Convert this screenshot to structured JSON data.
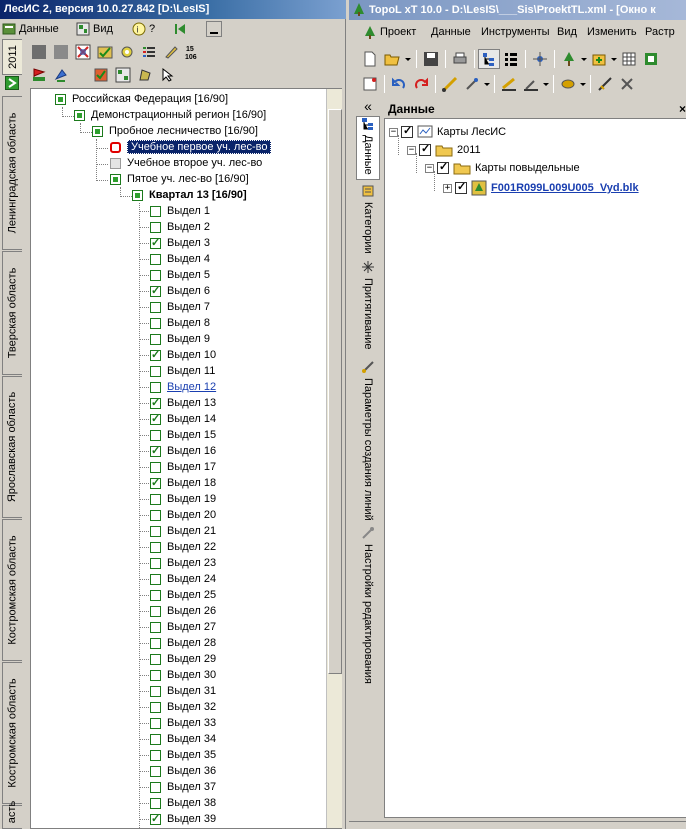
{
  "left_window": {
    "title": "ЛесИС 2, версия 10.0.27.842  [D:\\LesIS]",
    "menu": {
      "data_label": "Данные",
      "view_label": "Вид",
      "help_label": "?"
    },
    "vertical_tabs": [
      "2011",
      "Ленинградская область",
      "Тверская область",
      "Ярославская область",
      "Костромская область",
      "Костромская область",
      "асть"
    ],
    "tree": {
      "root": "Российская Федерация [16/90]",
      "region": "Демонстрационный  регион [16/90]",
      "forestry": "Пробное лесничество [16/90]",
      "districts": [
        "Учебное первое уч. лес-во",
        "Учебное второе уч. лес-во",
        "Пятое уч. лес-во [16/90]"
      ],
      "quarter": "Квартал 13 [16/90]",
      "plots": [
        {
          "label": "Выдел 1",
          "checked": false
        },
        {
          "label": "Выдел 2",
          "checked": false
        },
        {
          "label": "Выдел 3",
          "checked": true
        },
        {
          "label": "Выдел 4",
          "checked": false
        },
        {
          "label": "Выдел 5",
          "checked": false
        },
        {
          "label": "Выдел 6",
          "checked": true
        },
        {
          "label": "Выдел 7",
          "checked": false
        },
        {
          "label": "Выдел 8",
          "checked": false
        },
        {
          "label": "Выдел 9",
          "checked": false
        },
        {
          "label": "Выдел 10",
          "checked": true
        },
        {
          "label": "Выдел 11",
          "checked": false
        },
        {
          "label": "Выдел 12",
          "checked": false
        },
        {
          "label": "Выдел 13",
          "checked": true
        },
        {
          "label": "Выдел 14",
          "checked": true
        },
        {
          "label": "Выдел 15",
          "checked": false
        },
        {
          "label": "Выдел 16",
          "checked": true
        },
        {
          "label": "Выдел 17",
          "checked": false
        },
        {
          "label": "Выдел 18",
          "checked": true
        },
        {
          "label": "Выдел 19",
          "checked": false
        },
        {
          "label": "Выдел 20",
          "checked": false
        },
        {
          "label": "Выдел 21",
          "checked": false
        },
        {
          "label": "Выдел 22",
          "checked": false
        },
        {
          "label": "Выдел 23",
          "checked": false
        },
        {
          "label": "Выдел 24",
          "checked": false
        },
        {
          "label": "Выдел 25",
          "checked": false
        },
        {
          "label": "Выдел 26",
          "checked": false
        },
        {
          "label": "Выдел 27",
          "checked": false
        },
        {
          "label": "Выдел 28",
          "checked": false
        },
        {
          "label": "Выдел 29",
          "checked": false
        },
        {
          "label": "Выдел 30",
          "checked": false
        },
        {
          "label": "Выдел 31",
          "checked": false
        },
        {
          "label": "Выдел 32",
          "checked": false
        },
        {
          "label": "Выдел 33",
          "checked": false
        },
        {
          "label": "Выдел 34",
          "checked": false
        },
        {
          "label": "Выдел 35",
          "checked": false
        },
        {
          "label": "Выдел 36",
          "checked": false
        },
        {
          "label": "Выдел 37",
          "checked": false
        },
        {
          "label": "Выдел 38",
          "checked": false
        },
        {
          "label": "Выдел 39",
          "checked": true
        }
      ],
      "link_plot": "Выдел 12"
    }
  },
  "right_window": {
    "title": "TopoL xT 10.0 - D:\\LesIS\\___Sis\\ProektTL.xml - [Окно к",
    "menu": [
      "Проект",
      "Данные",
      "Инструменты",
      "Вид",
      "Изменить",
      "Растр"
    ],
    "side_tabs": [
      "Данные",
      "Категории",
      "Притягивание",
      "Параметры создания линий",
      "Настройки редактирования"
    ],
    "panel_title": "Данные",
    "collapse_glyph": "«",
    "close_glyph": "×",
    "tree": {
      "root": "Карты ЛесИС",
      "year": "2011",
      "folder": "Карты повыдельные",
      "file": "F001R099L009U005_Vyd.blk"
    }
  },
  "icons": {
    "toolbar_numbers": "15/106"
  }
}
